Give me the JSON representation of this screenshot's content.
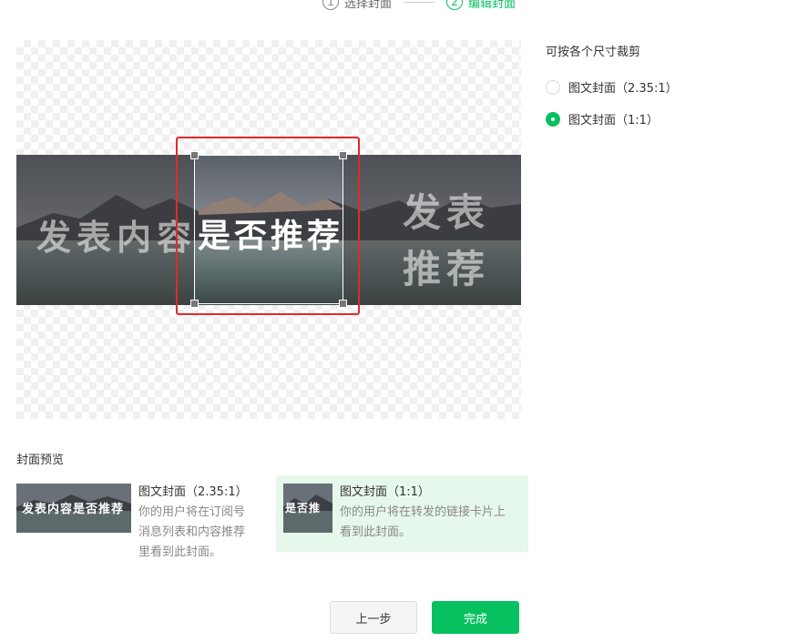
{
  "steps": [
    {
      "num": "1",
      "label": "选择封面",
      "active": false
    },
    {
      "num": "2",
      "label": "编辑封面",
      "active": true
    }
  ],
  "editor": {
    "left_text": "发表内容",
    "center_text": "是否推荐",
    "right_line1": "发表",
    "right_line2": "推荐"
  },
  "crop_options": {
    "title": "可按各个尺寸裁剪",
    "items": [
      {
        "label": "图文封面（2.35:1）",
        "checked": false
      },
      {
        "label": "图文封面（1:1）",
        "checked": true
      }
    ]
  },
  "preview": {
    "title": "封面预览",
    "cards": [
      {
        "thumb_text": "发表内容是否推荐",
        "name": "图文封面（2.35:1）",
        "desc_lines": [
          "你的用户将在订阅号",
          "消息列表和内容推荐",
          "里看到此封面。"
        ]
      },
      {
        "thumb_text": "是否推",
        "name": "图文封面（1:1）",
        "desc_lines": [
          "你的用户将在转发的链接卡片上",
          "看到此封面。"
        ]
      }
    ]
  },
  "buttons": {
    "prev": "上一步",
    "done": "完成"
  },
  "colors": {
    "accent": "#07c160",
    "crop_highlight": "#e02a2a",
    "selected_bg": "#e6f7ec"
  },
  "icons": [
    "landscape-image",
    "crop-handle"
  ]
}
